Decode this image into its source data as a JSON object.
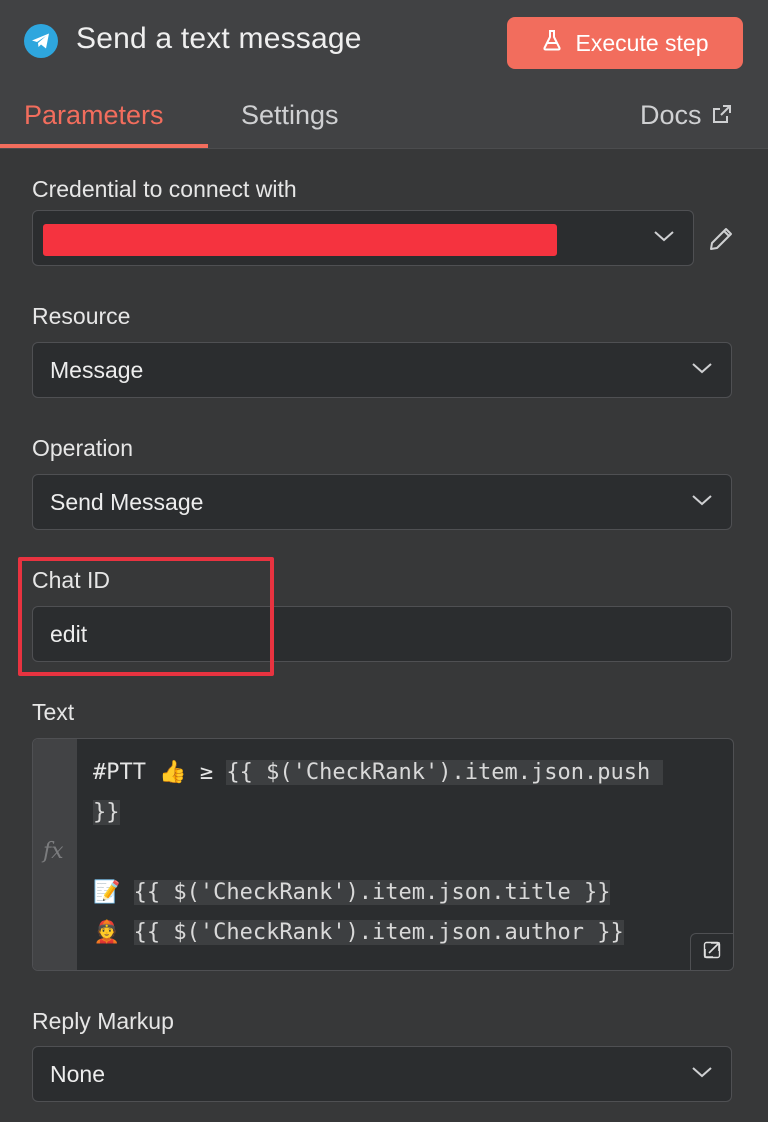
{
  "header": {
    "title": "Send a text message",
    "execute_label": "Execute step"
  },
  "tabs": {
    "parameters": "Parameters",
    "settings": "Settings",
    "docs": "Docs"
  },
  "fields": {
    "credential": {
      "label": "Credential to connect with",
      "value": ""
    },
    "resource": {
      "label": "Resource",
      "value": "Message"
    },
    "operation": {
      "label": "Operation",
      "value": "Send Message"
    },
    "chat_id": {
      "label": "Chat ID",
      "value": "edit"
    },
    "text": {
      "label": "Text",
      "fx": "fx",
      "line1_prefix": "#PTT 👍 ≥ ",
      "line1_expr": "{{ $('CheckRank').item.json.push ",
      "line2_expr": "}}",
      "line4_prefix": "📝 ",
      "line4_expr": "{{ $('CheckRank').item.json.title }}",
      "line5_prefix": "👲 ",
      "line5_expr": "{{ $('CheckRank').item.json.author }}"
    },
    "reply_markup": {
      "label": "Reply Markup",
      "value": "None"
    }
  },
  "colors": {
    "accent": "#f26d5d",
    "telegram": "#2ea6de",
    "redaction": "#f5333f",
    "highlight": "#e83340"
  },
  "icons": [
    "telegram-icon",
    "flask-icon",
    "external-link-icon",
    "chevron-down-icon",
    "pencil-icon",
    "expand-icon"
  ]
}
